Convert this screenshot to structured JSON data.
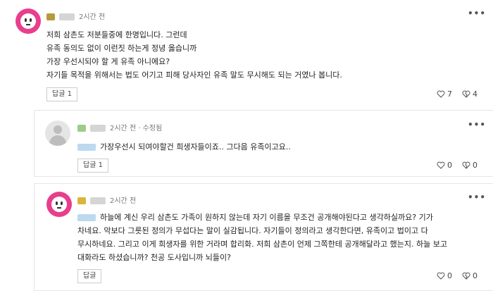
{
  "comments": [
    {
      "time": "2시간 전",
      "more": "•••",
      "lines": [
        "저희 삼촌도 저분들중에 한명입니다. 그런데",
        "유족 동의도 없이 이런짓 하는게 정녕 옳습니까",
        "가장 우선시되야 할 게 유족 아니에요?",
        "자기들 목적을 위해서는 법도 어기고 피해 당사자인 유족 말도 무시해도 되는 거였나 봅니다."
      ],
      "reply_label": "답글 1",
      "likes": "7",
      "replies_count": "4"
    }
  ],
  "replies": [
    {
      "time": "2시간 전 · 수정됨",
      "more": "•••",
      "lines": [
        "가장우선시 되여야할건 희생자들이죠.. 그다음 유족이고요.."
      ],
      "reply_label": "답글 1",
      "likes": "0",
      "dislikes": "0"
    },
    {
      "time": "2시간 전",
      "more": "•••",
      "lines": [
        "하늘에 계신 우리 삼촌도 가족이 원하지 않는데 자기 이름을 무조건 공개해야된다고 생각하실까요? 기가",
        "차네요. 악보다 그릇된 정의가 무섭다는 말이 실감됩니다. 자기들이 정의라고 생각한다면, 유족이고 법이고 다",
        "무시하네요. 그리고 이게 희생자를 위한 거라며 합리화. 저희 삼촌이 언제 그쪽한테 공개해달라고 했는지. 하늘 보고",
        "대화라도 하셨습니까? 천공 도사입니까 뇌들이?"
      ],
      "reply_label": "답글",
      "likes": "0",
      "dislikes": "0"
    }
  ],
  "colors": {
    "avatar_pink": "#e83e8c",
    "border": "#e6e6e6",
    "text": "#222222",
    "meta": "#777777"
  },
  "icons": {
    "like": "heart-outline-icon",
    "dislike": "broken-heart-icon",
    "more": "more-dots-icon"
  }
}
